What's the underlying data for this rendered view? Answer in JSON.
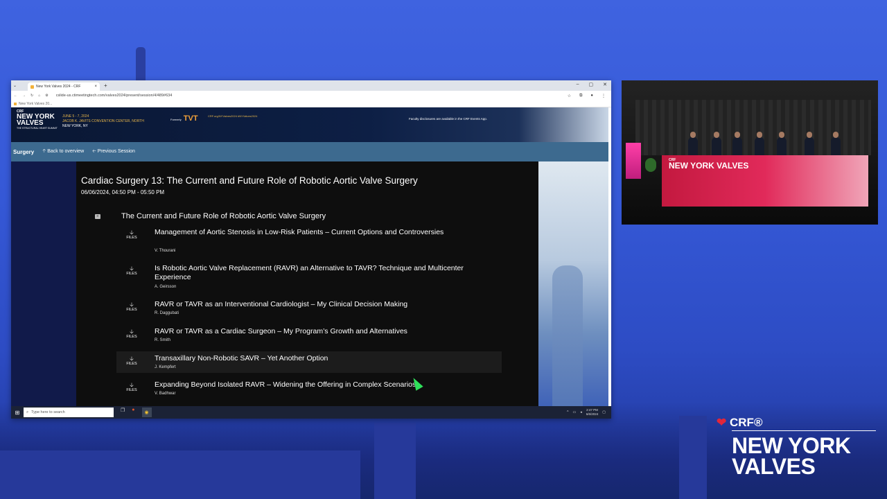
{
  "browser": {
    "tab_title": "New York Valves 2024 - CRF",
    "url": "cslide-us.ctimeetingtech.com/valves2024/present/session/4/489#634",
    "bookmark": "New York Valves 20..."
  },
  "banner": {
    "crf": "CRF",
    "logo": "NEW YORK VALVES",
    "logo_sub": "THE STRUCTURAL HEART SUMMIT",
    "dates": "JUNE 5 - 7, 2024",
    "venue": "JACOB K. JAVITS CONVENTION CENTER, NORTH",
    "city": "NEW YORK, NY",
    "formerly": "Formerly",
    "tvt": "TVT",
    "hashtags": "CRF.org/NYValves2024 #NYValves2024",
    "disclosure": "Faculty disclosures are available in the CRF Events App."
  },
  "nav": {
    "brand": "Surgery",
    "back": "Back to overview",
    "previous": "Previous Session"
  },
  "session": {
    "title": "Cardiac Surgery 13: The Current and Future Role of Robotic Aortic Valve Surgery",
    "time": "06/06/2024, 04:50 PM - 05:50 PM",
    "section_title": "The Current and Future Role of Robotic Aortic Valve Surgery",
    "files_label": "FILES",
    "talks": [
      {
        "title": "Management of Aortic Stenosis in Low-Risk Patients – Current Options and Controversies",
        "author": "V. Thourani"
      },
      {
        "title": "Is Robotic Aortic Valve Replacement (RAVR) an Alternative to TAVR? Technique and Multicenter Experience",
        "author": "A. Geirsson"
      },
      {
        "title": "RAVR or TAVR as an Interventional Cardiologist – My Clinical Decision Making",
        "author": "R. Daggubati"
      },
      {
        "title": "RAVR or TAVR as a Cardiac Surgeon – My Program’s Growth and Alternatives",
        "author": "R. Smith"
      },
      {
        "title": "Transaxillary Non-Robotic SAVR – Yet Another Option",
        "author": "J. Kempfert"
      },
      {
        "title": "Expanding Beyond Isolated RAVR – Widening the Offering in Complex Scenarios",
        "author": "V. Badhwar"
      }
    ]
  },
  "taskbar": {
    "search_placeholder": "Type here to search",
    "time": "2:47 PM",
    "date": "6/6/2024"
  },
  "video": {
    "table_logo": "NEW YORK VALVES",
    "table_crf": "CRF"
  },
  "corner_logo": {
    "crf": "CRF",
    "title_line1": "NEW YORK",
    "title_line2": "VALVES"
  }
}
